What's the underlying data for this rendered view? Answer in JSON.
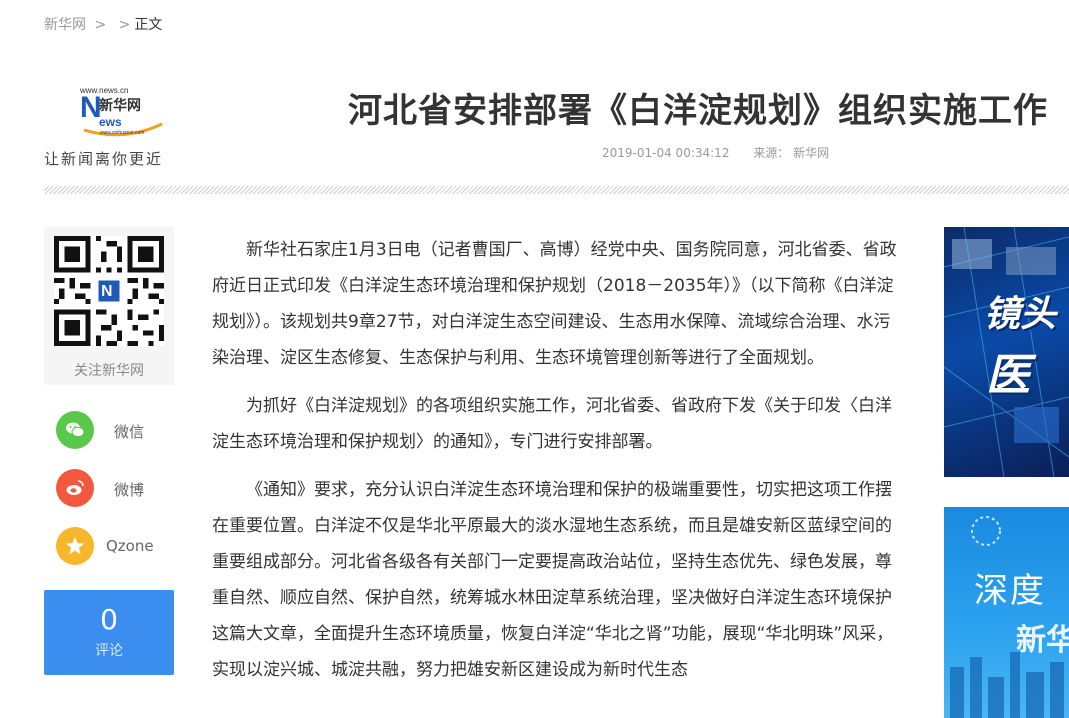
{
  "breadcrumb": {
    "home": "新华网",
    "sep1": ">",
    "sep2": ">",
    "current": "正文"
  },
  "logo": {
    "url_text": "www.news.cn",
    "brand": "新华网",
    "news_word": "News",
    "url_small": "www.xinhuanet.com",
    "slogan": "让新闻离你更近"
  },
  "article_header": {
    "title": "河北省安排部署《白洋淀规划》组织实施工作",
    "date": "2019-01-04 00:34:12",
    "source": "来源：  新华网"
  },
  "share": {
    "qr_label": "关注新华网",
    "items": [
      {
        "label": "微信",
        "icon": "wechat-icon",
        "color": "#5ac84a"
      },
      {
        "label": "微博",
        "icon": "weibo-icon",
        "color": "#f2583e"
      },
      {
        "label": "Qzone",
        "icon": "qzone-icon",
        "color": "#f8b62d"
      }
    ],
    "comment_count": "0",
    "comment_label": "评论"
  },
  "article": {
    "paragraphs": [
      "新华社石家庄1月3日电（记者曹国厂、高博）经党中央、国务院同意，河北省委、省政府近日正式印发《白洋淀生态环境治理和保护规划（2018－2035年）》（以下简称《白洋淀规划》）。该规划共9章27节，对白洋淀生态空间建设、生态用水保障、流域综合治理、水污染治理、淀区生态修复、生态保护与利用、生态环境管理创新等进行了全面规划。",
      "为抓好《白洋淀规划》的各项组织实施工作，河北省委、省政府下发《关于印发〈白洋淀生态环境治理和保护规划〉的通知》，专门进行安排部署。",
      "《通知》要求，充分认识白洋淀生态环境治理和保护的极端重要性，切实把这项工作摆在重要位置。白洋淀不仅是华北平原最大的淡水湿地生态系统，而且是雄安新区蓝绿空间的重要组成部分。河北省各级各有关部门一定要提高政治站位，坚持生态优先、绿色发展，尊重自然、顺应自然、保护自然，统筹城水林田淀草系统治理，坚决做好白洋淀生态环境保护这篇大文章，全面提升生态环境质量，恢复白洋淀“华北之肾”功能，展现“华北明珠”风采，实现以淀兴城、城淀共融，努力把雄安新区建设成为新时代生态"
    ]
  },
  "ads": {
    "ad1_text1": "镜头",
    "ad1_text2": "医",
    "ad2_text1": "深度",
    "ad2_text2": "新华"
  },
  "colors": {
    "accent": "#3c8df0",
    "text": "#333333",
    "muted": "#999999"
  }
}
